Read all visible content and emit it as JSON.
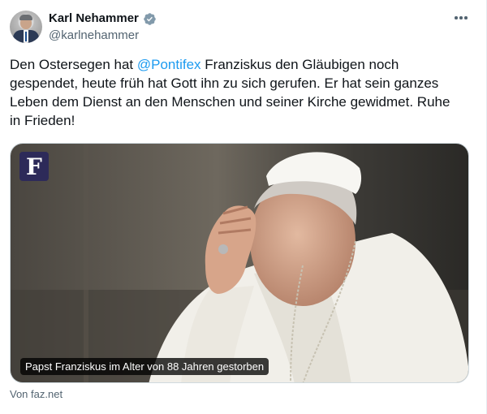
{
  "author": {
    "name": "Karl Nehammer",
    "handle": "@karlnehammer",
    "verified_icon": "verified-badge-icon"
  },
  "post": {
    "text_line1_before": "Den Ostersegen hat ",
    "mention": "@Pontifex",
    "text_line1_after": " Franziskus den Gläubigen noch",
    "text_line2": "gespendet, heute früh hat Gott ihn zu sich gerufen. Er hat sein ganzes",
    "text_line3": "Leben dem Dienst an den Menschen und seiner Kirche gewidmet. Ruhe",
    "text_line4": "in Frieden!"
  },
  "link_card": {
    "logo_letter": "F",
    "caption": "Papst Franziskus im Alter von 88 Jahren gestorben",
    "source": "Von faz.net"
  },
  "colors": {
    "accent": "#1d9bf0",
    "secondary_text": "#536471",
    "logo_bg": "#2d2a59"
  }
}
